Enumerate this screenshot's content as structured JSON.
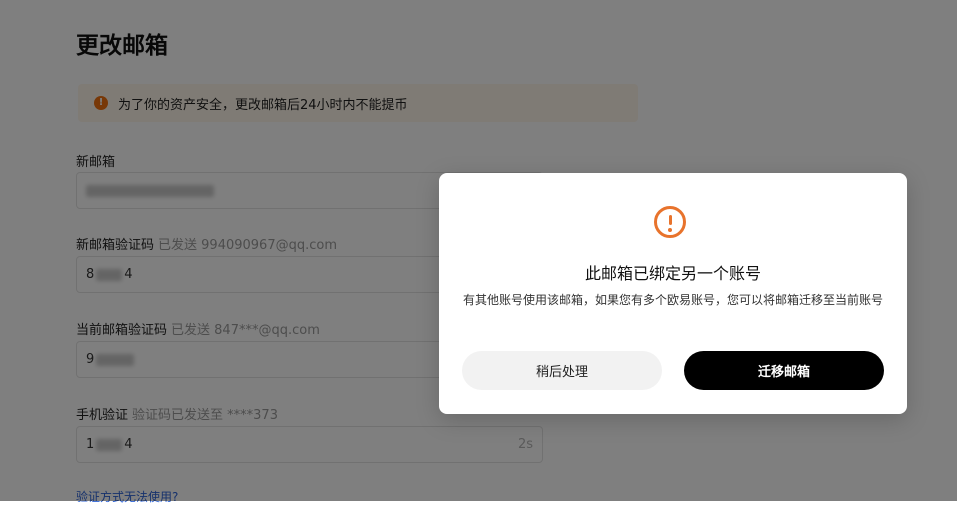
{
  "page": {
    "title": "更改邮箱",
    "notice": "为了你的资产安全，更改邮箱后24小时内不能提币",
    "recovery_link": "验证方式无法使用?"
  },
  "fields": [
    {
      "label": "新邮箱",
      "hint": "",
      "value": "",
      "suffix": ""
    },
    {
      "label": "新邮箱验证码",
      "hint": "已发送 994090967@qq.com",
      "value": "8",
      "suffix": "4"
    },
    {
      "label": "当前邮箱验证码",
      "hint": "已发送 847***@qq.com",
      "value": "9",
      "suffix": ""
    },
    {
      "label": "手机验证",
      "hint": "验证码已发送至 ****373",
      "value": "1",
      "suffix": "4",
      "countdown": "2s"
    }
  ],
  "modal": {
    "icon": "warning-circle-icon",
    "title": "此邮箱已绑定另一个账号",
    "description": "有其他账号使用该邮箱，如果您有多个欧易账号，您可以将邮箱迁移至当前账号",
    "later_button": "稍后处理",
    "migrate_button": "迁移邮箱"
  },
  "colors": {
    "accent": "#e8732c",
    "notice_bg": "#fff7ea",
    "primary_button": "#000000",
    "secondary_button": "#f2f2f2",
    "overlay": "rgba(0,0,0,0.5)"
  }
}
